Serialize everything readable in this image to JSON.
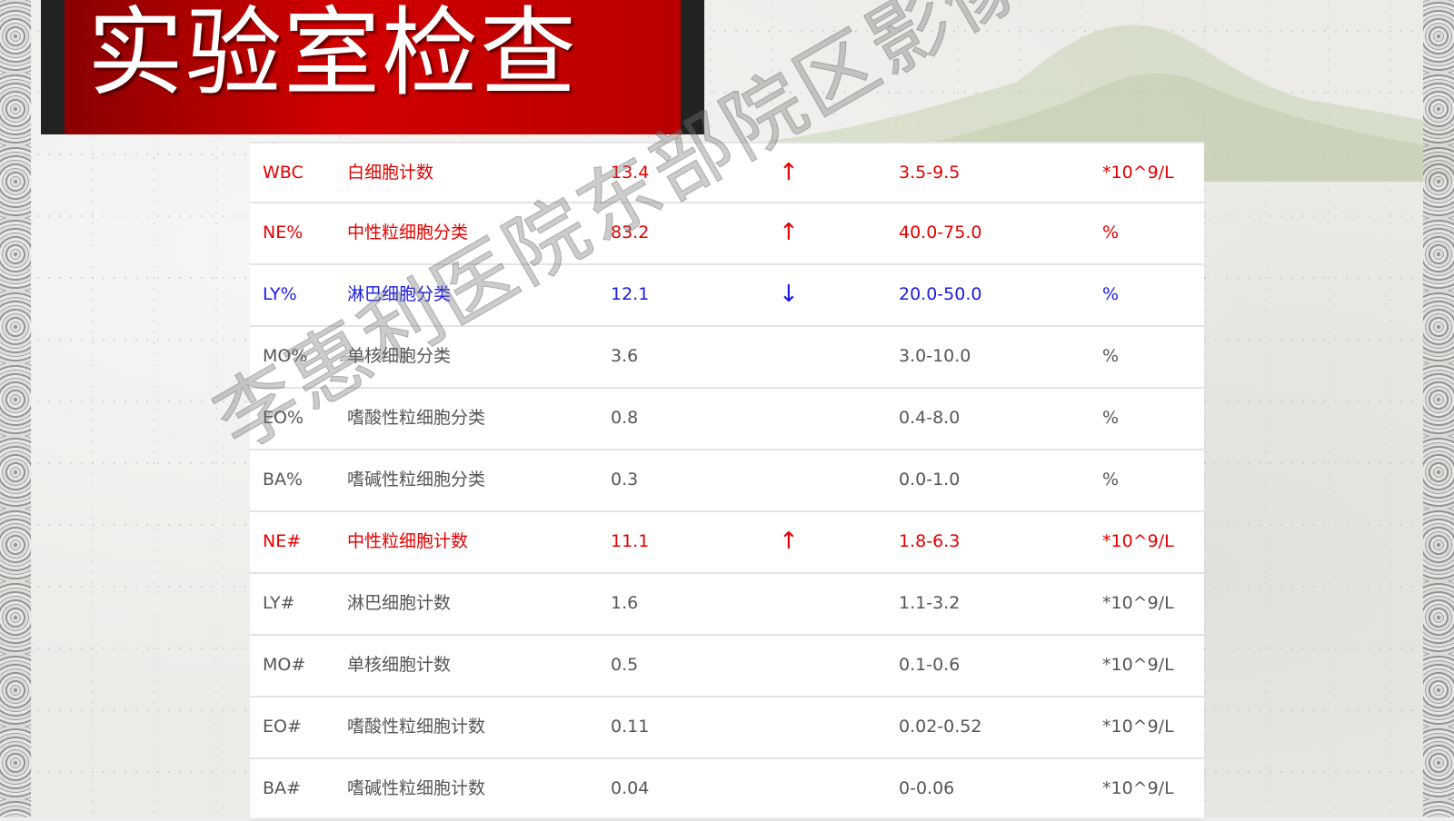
{
  "title": "实验室检查",
  "watermark": "李惠利医院东部院区影像科",
  "rows": [
    {
      "code": "WBC",
      "name": "白细胞计数",
      "value": "13.4",
      "flag": "↑",
      "range": "3.5-9.5",
      "unit": "*10^9/L",
      "status": "high"
    },
    {
      "code": "NE%",
      "name": "中性粒细胞分类",
      "value": "83.2",
      "flag": "↑",
      "range": "40.0-75.0",
      "unit": "%",
      "status": "high"
    },
    {
      "code": "LY%",
      "name": "淋巴细胞分类",
      "value": "12.1",
      "flag": "↓",
      "range": "20.0-50.0",
      "unit": "%",
      "status": "low"
    },
    {
      "code": "MO%",
      "name": "单核细胞分类",
      "value": "3.6",
      "flag": "",
      "range": "3.0-10.0",
      "unit": "%",
      "status": "normal"
    },
    {
      "code": "EO%",
      "name": "嗜酸性粒细胞分类",
      "value": "0.8",
      "flag": "",
      "range": "0.4-8.0",
      "unit": "%",
      "status": "normal"
    },
    {
      "code": "BA%",
      "name": "嗜碱性粒细胞分类",
      "value": "0.3",
      "flag": "",
      "range": "0.0-1.0",
      "unit": "%",
      "status": "normal"
    },
    {
      "code": "NE#",
      "name": "中性粒细胞计数",
      "value": "11.1",
      "flag": "↑",
      "range": "1.8-6.3",
      "unit": "*10^9/L",
      "status": "high"
    },
    {
      "code": "LY#",
      "name": "淋巴细胞计数",
      "value": "1.6",
      "flag": "",
      "range": "1.1-3.2",
      "unit": "*10^9/L",
      "status": "normal"
    },
    {
      "code": "MO#",
      "name": "单核细胞计数",
      "value": "0.5",
      "flag": "",
      "range": "0.1-0.6",
      "unit": "*10^9/L",
      "status": "normal"
    },
    {
      "code": "EO#",
      "name": "嗜酸性粒细胞计数",
      "value": "0.11",
      "flag": "",
      "range": "0.02-0.52",
      "unit": "*10^9/L",
      "status": "normal"
    },
    {
      "code": "BA#",
      "name": "嗜碱性粒细胞计数",
      "value": "0.04",
      "flag": "",
      "range": "0-0.06",
      "unit": "*10^9/L",
      "status": "normal"
    }
  ],
  "colors": {
    "high": "#e60000",
    "low": "#1a1ae6",
    "normal": "#555555",
    "title_bg": "#c00000"
  }
}
